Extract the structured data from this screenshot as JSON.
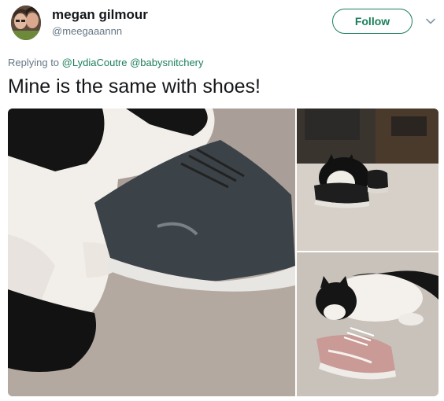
{
  "user": {
    "display_name": "megan gilmour",
    "handle": "@meegaaannn"
  },
  "follow_label": "Follow",
  "reply": {
    "prefix": "Replying to",
    "mentions": [
      "@LydiaCoutre",
      "@babysnitchery"
    ]
  },
  "tweet_text": "Mine is the same with shoes!",
  "colors": {
    "accent": "#1b7f5a",
    "secondary_text": "#657786"
  },
  "icons": {
    "menu": "chevron-down-icon"
  }
}
